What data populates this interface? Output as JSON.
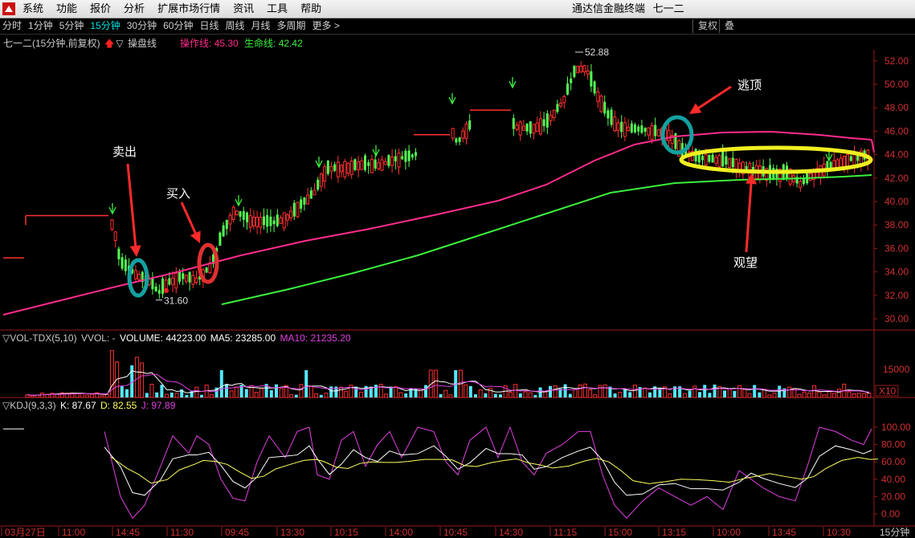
{
  "menu": {
    "items": [
      "系统",
      "功能",
      "报价",
      "分析",
      "扩展市场行情",
      "资讯",
      "工具",
      "帮助"
    ],
    "app_title": "通达信金融终端",
    "stock_name": "七一二"
  },
  "period_bar": {
    "items": [
      "分时",
      "1分钟",
      "5分钟",
      "15分钟",
      "30分钟",
      "60分钟",
      "日线",
      "周线",
      "月线",
      "多周期",
      "更多 >"
    ],
    "active": "15分钟",
    "fuquan_button": "复权",
    "overlay_button": "叠"
  },
  "main_chart": {
    "title": "七一二(15分钟,前复权)",
    "indicator_name": "操盘线",
    "ops_line_label": "操作线: 45.30",
    "life_line_label": "生命线: 42.42",
    "price_ticks": [
      "52.00",
      "50.00",
      "48.00",
      "46.00",
      "44.00",
      "42.00",
      "40.00",
      "38.00",
      "36.00",
      "34.00",
      "32.00",
      "30.00"
    ],
    "high_label": "52.88",
    "low_label": "31.60",
    "colors": {
      "up": "#ff3030",
      "down": "#54ff54",
      "ops_line": "#ff2c8c",
      "life_line": "#3cf03c"
    }
  },
  "volume_panel": {
    "name": "VOL-TDX(5,10)",
    "vvol": "VVOL: -",
    "volume": "VOLUME: 44223.00",
    "ma5": "MA5: 23285.00",
    "ma10": "MA10: 21235.20",
    "tick": "15000",
    "unit": "X10"
  },
  "kdj_panel": {
    "name": "KDJ(9,3,3)",
    "k": "K: 87.67",
    "d": "D: 82.55",
    "j": "J: 97.89",
    "ticks": [
      "100.00",
      "80.00",
      "60.00",
      "40.00",
      "20.00",
      "0.00"
    ]
  },
  "time_axis": {
    "labels": [
      "03月27日",
      "11:00",
      "14:45",
      "11:30",
      "09:45",
      "13:30",
      "10:15",
      "14:00",
      "10:45",
      "14:30",
      "11:15",
      "15:00",
      "13:15",
      "10:00",
      "13:45",
      "10:30"
    ],
    "period_label": "15分钟"
  },
  "annotations": {
    "sell": "卖出",
    "buy": "买入",
    "escape_top": "逃顶",
    "wait": "观望"
  }
}
